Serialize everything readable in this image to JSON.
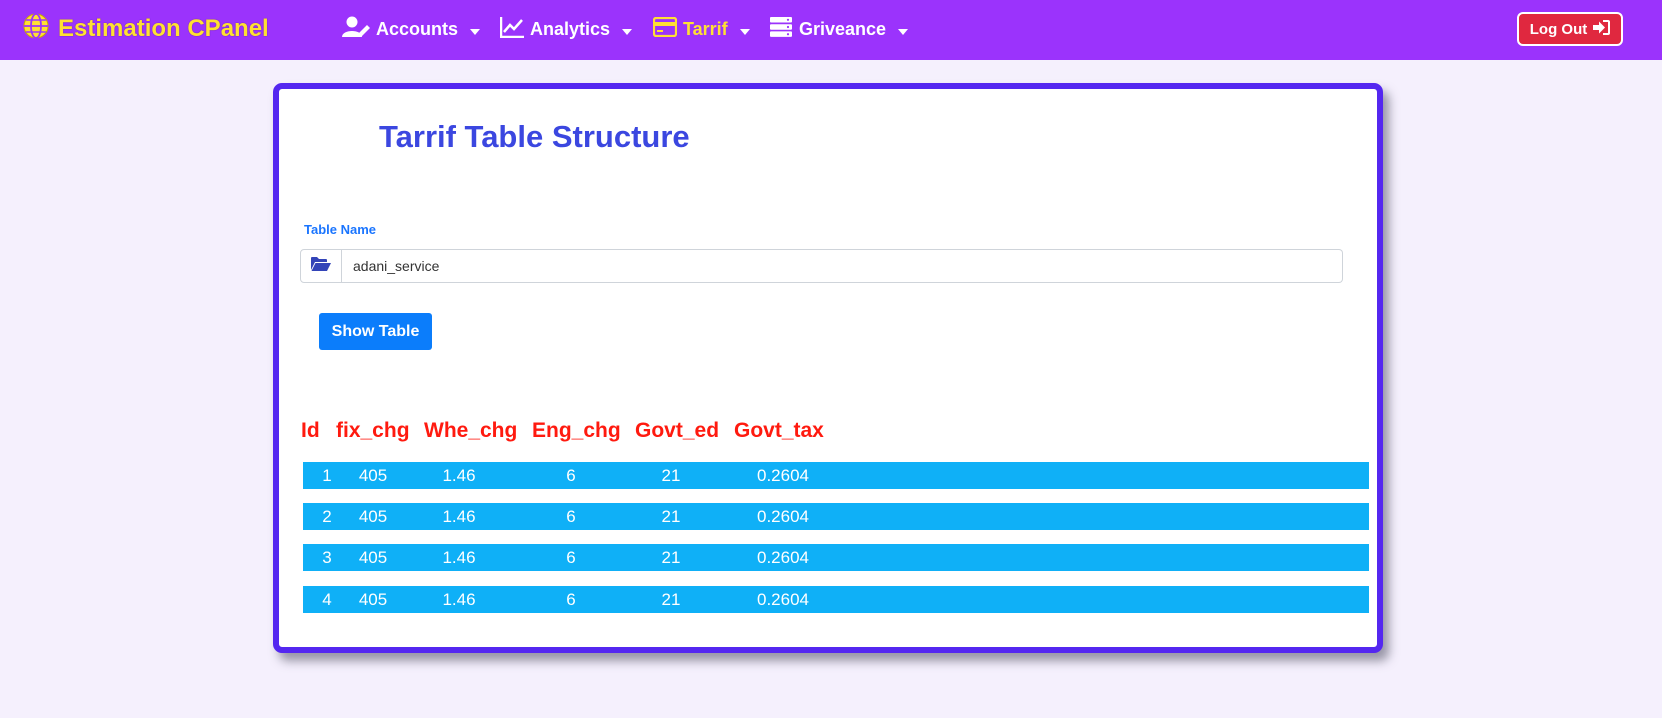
{
  "nav": {
    "brand": "Estimation CPanel",
    "items": [
      {
        "label": "Accounts",
        "icon": "user-edit-icon"
      },
      {
        "label": "Analytics",
        "icon": "chart-line-icon"
      },
      {
        "label": "Tarrif",
        "icon": "credit-card-icon"
      },
      {
        "label": "Griveance",
        "icon": "server-icon"
      }
    ],
    "logout": "Log Out",
    "brand_color": "#ffe033",
    "bar_color": "#9b33fc"
  },
  "card": {
    "title": "Tarrif Table Structure",
    "field_label": "Table Name",
    "input_value": "adani_service",
    "button": "Show Table"
  },
  "table": {
    "headers": [
      "Id",
      "fix_chg",
      "Whe_chg",
      "Eng_chg",
      "Govt_ed",
      "Govt_tax"
    ],
    "rows": [
      [
        "1",
        "405",
        "1.46",
        "6",
        "21",
        "0.2604"
      ],
      [
        "2",
        "405",
        "1.46",
        "6",
        "21",
        "0.2604"
      ],
      [
        "3",
        "405",
        "1.46",
        "6",
        "21",
        "0.2604"
      ],
      [
        "4",
        "405",
        "1.46",
        "6",
        "21",
        "0.2604"
      ]
    ],
    "header_color": "#ff1a0f",
    "row_color": "#0fb0f7"
  }
}
